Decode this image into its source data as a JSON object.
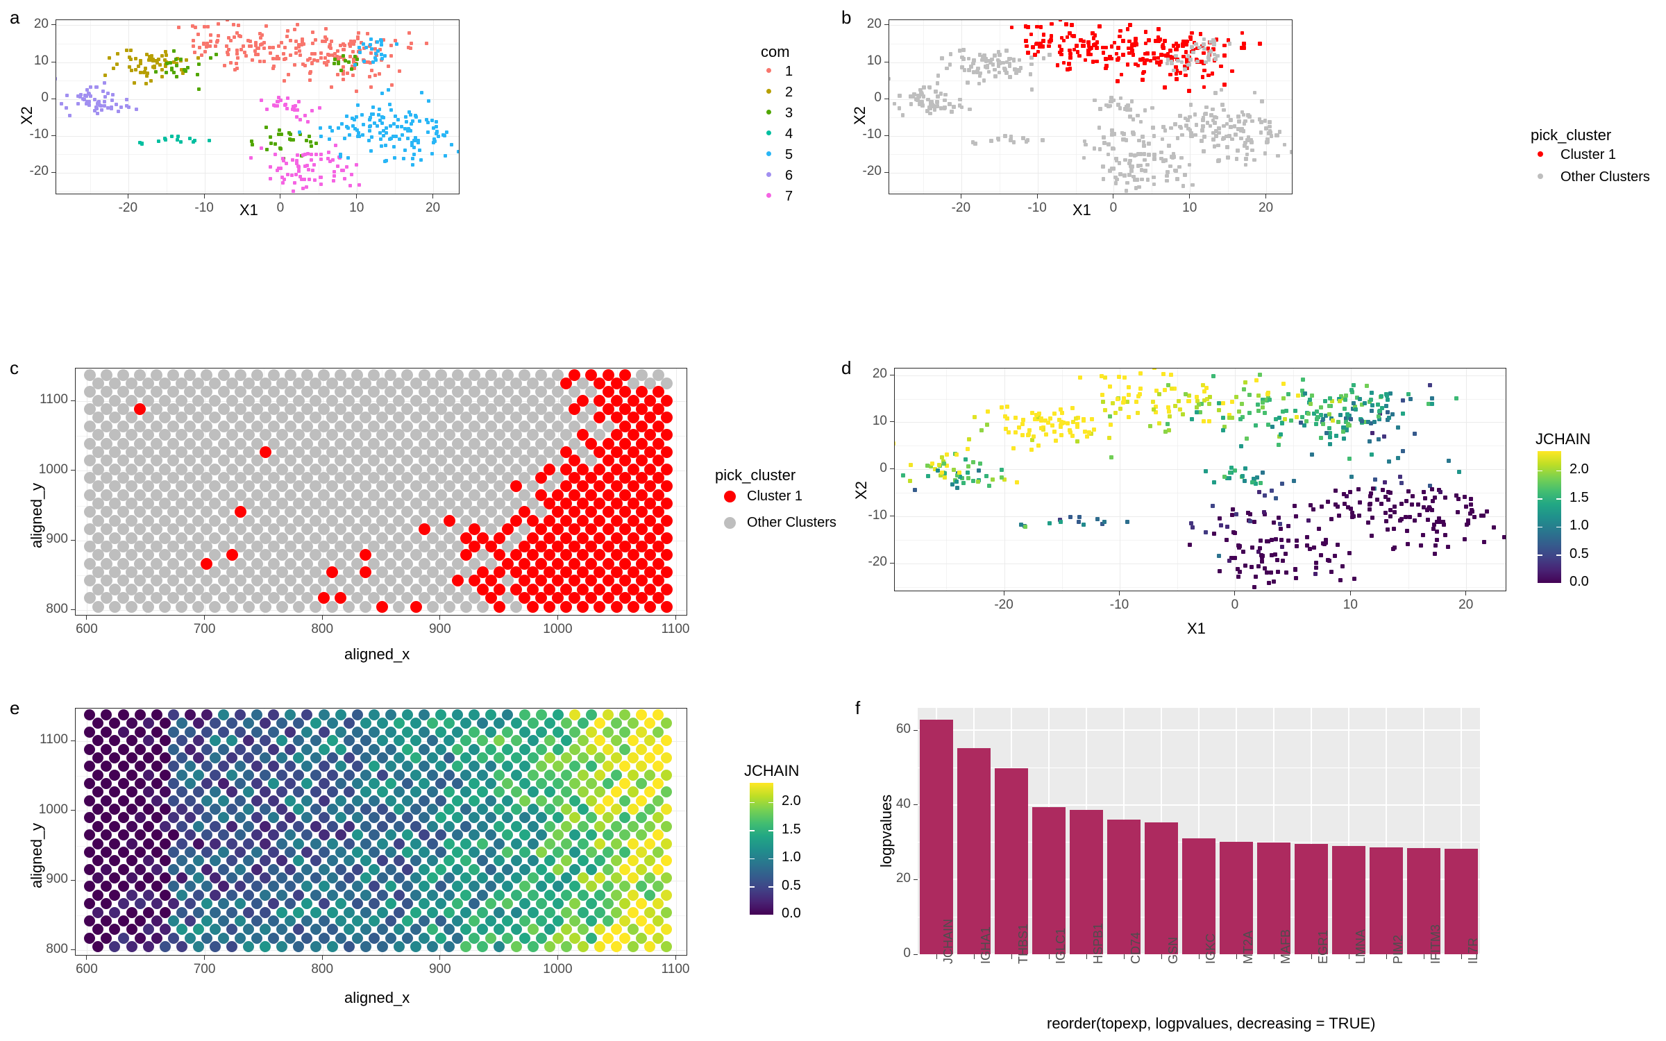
{
  "figure": {
    "panels": [
      "a",
      "b",
      "c",
      "d",
      "e",
      "f"
    ],
    "colors": {
      "com1": "#F8766D",
      "com2": "#B79F00",
      "com3": "#51A600",
      "com4": "#00BFA0",
      "com5": "#29B6F6",
      "com6": "#A18FF0",
      "com7": "#F564E3",
      "cluster1": "#FF0000",
      "other": "#BEBEBE",
      "bar": "#AD2A5F",
      "panel_grey": "#EBEBEB"
    }
  },
  "panel_a": {
    "label": "a",
    "xlabel": "X1",
    "ylabel": "X2",
    "xticks": [
      "-20",
      "-10",
      "0",
      "10",
      "20"
    ],
    "yticks": [
      "-20",
      "-10",
      "0",
      "10",
      "20"
    ],
    "legend": {
      "title": "com",
      "items": [
        {
          "label": "1",
          "color": "#F8766D"
        },
        {
          "label": "2",
          "color": "#B79F00"
        },
        {
          "label": "3",
          "color": "#51A600"
        },
        {
          "label": "4",
          "color": "#00BFA0"
        },
        {
          "label": "5",
          "color": "#29B6F6"
        },
        {
          "label": "6",
          "color": "#A18FF0"
        },
        {
          "label": "7",
          "color": "#F564E3"
        }
      ]
    },
    "chart_data": {
      "type": "scatter",
      "title": "",
      "xlabel": "X1",
      "ylabel": "X2",
      "xlim": [
        -29,
        23
      ],
      "ylim": [
        -25,
        21
      ],
      "grid": true,
      "legend_position": "right",
      "series": [
        {
          "name": "1",
          "color": "#F8766D",
          "n": 230
        },
        {
          "name": "2",
          "color": "#B79F00",
          "n": 60
        },
        {
          "name": "3",
          "color": "#51A600",
          "n": 45
        },
        {
          "name": "4",
          "color": "#00BFA0",
          "n": 15
        },
        {
          "name": "5",
          "color": "#29B6F6",
          "n": 150
        },
        {
          "name": "6",
          "color": "#A18FF0",
          "n": 55
        },
        {
          "name": "7",
          "color": "#F564E3",
          "n": 95
        }
      ]
    }
  },
  "panel_b": {
    "label": "b",
    "xlabel": "X1",
    "ylabel": "X2",
    "xticks": [
      "-20",
      "-10",
      "0",
      "10",
      "20"
    ],
    "yticks": [
      "-20",
      "-10",
      "0",
      "10",
      "20"
    ],
    "legend": {
      "title": "pick_cluster",
      "items": [
        {
          "label": "Cluster 1",
          "color": "#FF0000"
        },
        {
          "label": "Other Clusters",
          "color": "#BEBEBE"
        }
      ]
    },
    "chart_data": {
      "type": "scatter",
      "xlabel": "X1",
      "ylabel": "X2",
      "xlim": [
        -29,
        23
      ],
      "ylim": [
        -25,
        21
      ],
      "grid": true,
      "legend_position": "right",
      "series": [
        {
          "name": "Cluster 1",
          "color": "#FF0000",
          "n": 230
        },
        {
          "name": "Other Clusters",
          "color": "#BEBEBE",
          "n": 420
        }
      ]
    }
  },
  "panel_c": {
    "label": "c",
    "xlabel": "aligned_x",
    "ylabel": "aligned_y",
    "xticks": [
      "600",
      "700",
      "800",
      "900",
      "1000",
      "1100"
    ],
    "yticks": [
      "800",
      "900",
      "1000",
      "1100"
    ],
    "legend": {
      "title": "pick_cluster",
      "items": [
        {
          "label": "Cluster 1",
          "color": "#FF0000"
        },
        {
          "label": "Other Clusters",
          "color": "#BEBEBE"
        }
      ]
    },
    "chart_data": {
      "type": "scatter",
      "xlabel": "aligned_x",
      "ylabel": "aligned_y",
      "xlim": [
        590,
        1110
      ],
      "ylim": [
        790,
        1145
      ],
      "grid": true,
      "legend_position": "right",
      "description": "Hexagonal spot grid of spatial transcriptomics spots; Cluster 1 spots (red) occupy right/centre regions, other clusters grey."
    }
  },
  "panel_d": {
    "label": "d",
    "xlabel": "X1",
    "ylabel": "X2",
    "xticks": [
      "-20",
      "-10",
      "0",
      "10",
      "20"
    ],
    "yticks": [
      "-20",
      "-10",
      "0",
      "10",
      "20"
    ],
    "legend": {
      "title": "JCHAIN",
      "ticks": [
        "2.0",
        "1.5",
        "1.0",
        "0.5",
        "0.0"
      ],
      "min": 0.0,
      "max": 2.35,
      "colormap": "viridis"
    },
    "chart_data": {
      "type": "scatter",
      "xlabel": "X1",
      "ylabel": "X2",
      "xlim": [
        -29,
        23
      ],
      "ylim": [
        -25,
        21
      ],
      "grid": true,
      "legend_position": "right",
      "colorbar": {
        "label": "JCHAIN",
        "range": [
          0.0,
          2.35
        ],
        "ticks": [
          0.0,
          0.5,
          1.0,
          1.5,
          2.0
        ]
      }
    }
  },
  "panel_e": {
    "label": "e",
    "xlabel": "aligned_x",
    "ylabel": "aligned_y",
    "xticks": [
      "600",
      "700",
      "800",
      "900",
      "1000",
      "1100"
    ],
    "yticks": [
      "800",
      "900",
      "1000",
      "1100"
    ],
    "legend": {
      "title": "JCHAIN",
      "ticks": [
        "2.0",
        "1.5",
        "1.0",
        "0.5",
        "0.0"
      ],
      "min": 0.0,
      "max": 2.35,
      "colormap": "viridis"
    },
    "chart_data": {
      "type": "scatter",
      "xlabel": "aligned_x",
      "ylabel": "aligned_y",
      "xlim": [
        590,
        1110
      ],
      "ylim": [
        790,
        1145
      ],
      "grid": true,
      "legend_position": "right",
      "colorbar": {
        "label": "JCHAIN",
        "range": [
          0.0,
          2.35
        ],
        "ticks": [
          0.0,
          0.5,
          1.0,
          1.5,
          2.0
        ]
      },
      "description": "Spatial hex grid coloured by JCHAIN expression; higher values (green/yellow) toward right-centre."
    }
  },
  "panel_f": {
    "label": "f",
    "xlabel": "reorder(topexp, logpvalues, decreasing = TRUE)",
    "ylabel": "logpvalues",
    "yticks": [
      "0",
      "20",
      "40",
      "60"
    ],
    "chart_data": {
      "type": "bar",
      "title": "",
      "xlabel": "reorder(topexp, logpvalues, decreasing = TRUE)",
      "ylabel": "logpvalues",
      "ylim": [
        0,
        66
      ],
      "grid": true,
      "bar_color": "#AD2A5F",
      "categories": [
        "JCHAIN",
        "IGHA1",
        "THBS1",
        "IGLC1",
        "HSPB1",
        "CD74",
        "GSN",
        "IGKC",
        "MT2A",
        "MAFB",
        "EGR1",
        "LMNA",
        "PIM2",
        "IFITM3",
        "IL7R"
      ],
      "values": [
        62.8,
        55.2,
        49.8,
        39.5,
        38.6,
        36.0,
        35.4,
        31.0,
        30.2,
        30.0,
        29.6,
        29.0,
        28.7,
        28.5,
        28.2
      ]
    }
  }
}
